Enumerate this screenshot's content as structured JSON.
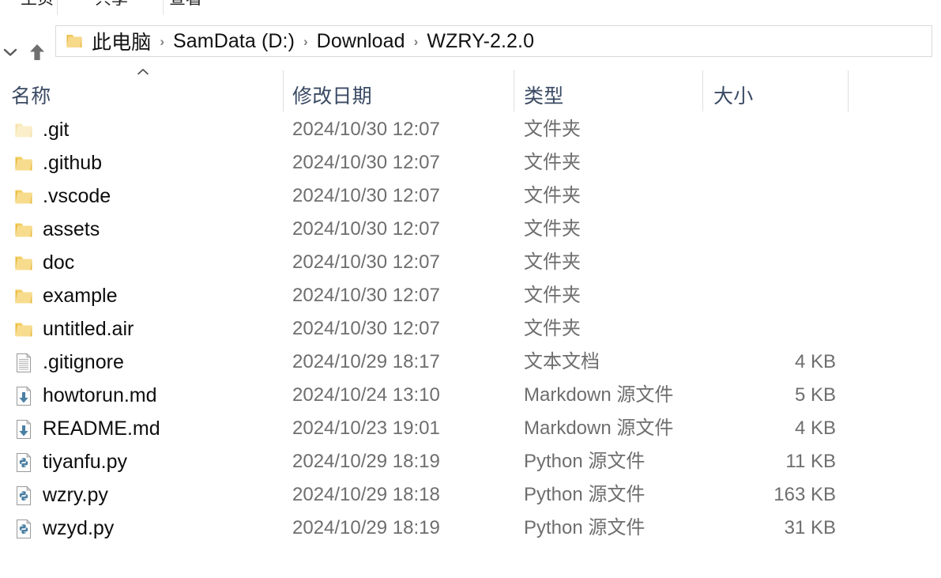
{
  "ribbon": {
    "tabs": [
      {
        "label": "主页",
        "name": "tab-home"
      },
      {
        "label": "共享",
        "name": "tab-share"
      },
      {
        "label": "查看",
        "name": "tab-view"
      }
    ]
  },
  "addressbar": {
    "recent_locations_tooltip": "最近使用的位置",
    "up_tooltip": "上移到",
    "folder_icon": "folder-icon",
    "separator": "›",
    "breadcrumb": [
      "此电脑",
      "SamData (D:)",
      "Download",
      "WZRY-2.2.0"
    ]
  },
  "columns": {
    "name": "名称",
    "date_modified": "修改日期",
    "type": "类型",
    "size": "大小",
    "sort_column": "名称",
    "sort_direction": "ascending"
  },
  "files": [
    {
      "name": ".git",
      "date": "2024/10/30 12:07",
      "type": "文件夹",
      "size": "",
      "icon": "folder-icon",
      "hidden": true
    },
    {
      "name": ".github",
      "date": "2024/10/30 12:07",
      "type": "文件夹",
      "size": "",
      "icon": "folder-icon",
      "hidden": false
    },
    {
      "name": ".vscode",
      "date": "2024/10/30 12:07",
      "type": "文件夹",
      "size": "",
      "icon": "folder-icon",
      "hidden": false
    },
    {
      "name": "assets",
      "date": "2024/10/30 12:07",
      "type": "文件夹",
      "size": "",
      "icon": "folder-icon",
      "hidden": false
    },
    {
      "name": "doc",
      "date": "2024/10/30 12:07",
      "type": "文件夹",
      "size": "",
      "icon": "folder-icon",
      "hidden": false
    },
    {
      "name": "example",
      "date": "2024/10/30 12:07",
      "type": "文件夹",
      "size": "",
      "icon": "folder-icon",
      "hidden": false
    },
    {
      "name": "untitled.air",
      "date": "2024/10/30 12:07",
      "type": "文件夹",
      "size": "",
      "icon": "folder-icon",
      "hidden": false
    },
    {
      "name": ".gitignore",
      "date": "2024/10/29 18:17",
      "type": "文本文档",
      "size": "4 KB",
      "icon": "text-file-icon",
      "hidden": false
    },
    {
      "name": "howtorun.md",
      "date": "2024/10/24 13:10",
      "type": "Markdown 源文件",
      "size": "5 KB",
      "icon": "markdown-file-icon",
      "hidden": false
    },
    {
      "name": "README.md",
      "date": "2024/10/23 19:01",
      "type": "Markdown 源文件",
      "size": "4 KB",
      "icon": "markdown-file-icon",
      "hidden": false
    },
    {
      "name": "tiyanfu.py",
      "date": "2024/10/29 18:19",
      "type": "Python 源文件",
      "size": "11 KB",
      "icon": "python-file-icon",
      "hidden": false
    },
    {
      "name": "wzry.py",
      "date": "2024/10/29 18:18",
      "type": "Python 源文件",
      "size": "163 KB",
      "icon": "python-file-icon",
      "hidden": false
    },
    {
      "name": "wzyd.py",
      "date": "2024/10/29 18:19",
      "type": "Python 源文件",
      "size": "31 KB",
      "icon": "python-file-icon",
      "hidden": false
    }
  ],
  "colors": {
    "folder": "#f5c85c",
    "python_blue": "#4b7fa3",
    "markdown_blue": "#4b7fa3",
    "header_text": "#3a4a63",
    "secondary_text": "#6e6e6e",
    "primary_text": "#0d0d0d"
  }
}
